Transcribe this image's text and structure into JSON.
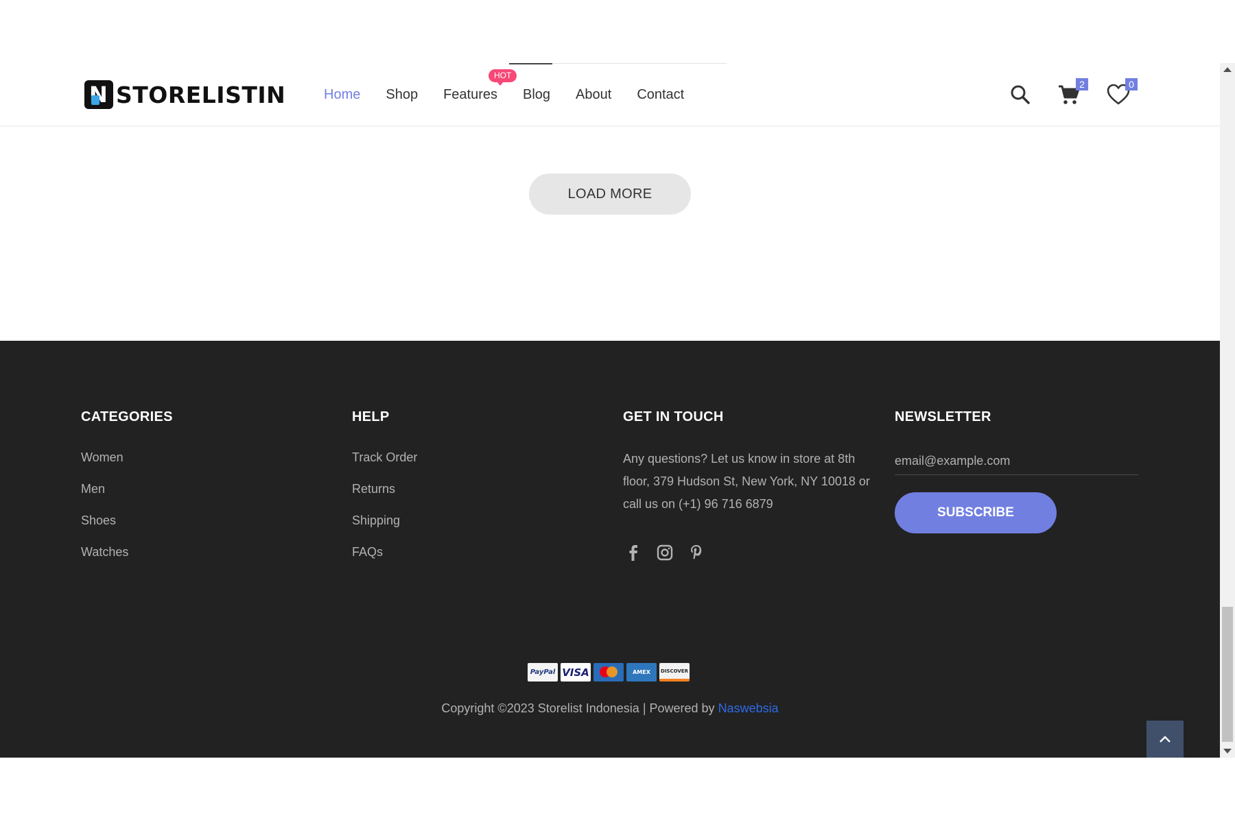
{
  "header": {
    "logo_text": "STORELISTIN",
    "logo_letter": "N",
    "nav": [
      {
        "label": "Home",
        "active": true
      },
      {
        "label": "Shop",
        "active": false
      },
      {
        "label": "Features",
        "active": false
      },
      {
        "label": "Blog",
        "active": false
      },
      {
        "label": "About",
        "active": false
      },
      {
        "label": "Contact",
        "active": false
      }
    ],
    "hot_badge": "HOT",
    "cart_count": "2",
    "wishlist_count": "0",
    "icons": [
      "search-icon",
      "cart-icon",
      "heart-icon"
    ]
  },
  "main": {
    "load_more_label": "LOAD MORE"
  },
  "footer": {
    "categories": {
      "title": "CATEGORIES",
      "items": [
        "Women",
        "Men",
        "Shoes",
        "Watches"
      ]
    },
    "help": {
      "title": "HELP",
      "items": [
        "Track Order",
        "Returns",
        "Shipping",
        "FAQs"
      ]
    },
    "touch": {
      "title": "GET IN TOUCH",
      "text": "Any questions? Let us know in store at 8th floor, 379 Hudson St, New York, NY 10018 or call us on (+1) 96 716 6879",
      "socials": [
        "facebook-icon",
        "instagram-icon",
        "pinterest-icon"
      ]
    },
    "newsletter": {
      "title": "NEWSLETTER",
      "placeholder": "email@example.com",
      "button": "SUBSCRIBE"
    },
    "payments": [
      "PayPal",
      "VISA",
      "MasterCard",
      "AMEX",
      "DISCOVER"
    ],
    "copyright_prefix": "Copyright ©2023 Storelist Indonesia | Powered by ",
    "copyright_link": "Naswebsia"
  },
  "colors": {
    "accent": "#717fe0",
    "hot": "#f74877",
    "footer_bg": "#222222",
    "link": "#2e6ae6"
  }
}
